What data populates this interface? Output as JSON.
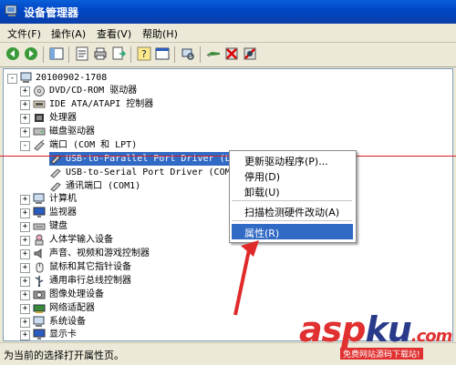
{
  "window": {
    "title": "设备管理器"
  },
  "menu": [
    {
      "label": "文件(F)"
    },
    {
      "label": "操作(A)"
    },
    {
      "label": "查看(V)"
    },
    {
      "label": "帮助(H)"
    }
  ],
  "tree": {
    "root": "20100902-1708",
    "items": [
      {
        "label": "DVD/CD-ROM 驱动器",
        "icon": "cdrom-icon",
        "expander": "+"
      },
      {
        "label": "IDE ATA/ATAPI 控制器",
        "icon": "ide-controller-icon",
        "expander": "+"
      },
      {
        "label": "处理器",
        "icon": "processor-icon",
        "expander": "+"
      },
      {
        "label": "磁盘驱动器",
        "icon": "disk-drive-icon",
        "expander": "+"
      },
      {
        "label": "端口 (COM 和 LPT)",
        "icon": "port-icon",
        "expander": "-"
      },
      {
        "label": "计算机",
        "icon": "computer-icon",
        "expander": "+"
      },
      {
        "label": "监视器",
        "icon": "monitor-icon",
        "expander": "+"
      },
      {
        "label": "键盘",
        "icon": "keyboard-icon",
        "expander": "+"
      },
      {
        "label": "人体学输入设备",
        "icon": "hid-icon",
        "expander": "+"
      },
      {
        "label": "声音、视频和游戏控制器",
        "icon": "sound-icon",
        "expander": "+"
      },
      {
        "label": "鼠标和其它指针设备",
        "icon": "mouse-icon",
        "expander": "+"
      },
      {
        "label": "通用串行总线控制器",
        "icon": "usb-icon",
        "expander": "+"
      },
      {
        "label": "图像处理设备",
        "icon": "imaging-icon",
        "expander": "+"
      },
      {
        "label": "网络适配器",
        "icon": "network-icon",
        "expander": "+"
      },
      {
        "label": "系统设备",
        "icon": "system-icon",
        "expander": "+"
      },
      {
        "label": "显示卡",
        "icon": "display-icon",
        "expander": "+"
      }
    ],
    "ports": [
      {
        "label": "USB-to-Parallel Port Driver (LPT1)",
        "selected": true
      },
      {
        "label": "USB-to-Serial Port Driver (COM4)",
        "selected": false
      },
      {
        "label": "通讯端口 (COM1)",
        "selected": false
      }
    ]
  },
  "context_menu": {
    "items": [
      {
        "label": "更新驱动程序(P)..."
      },
      {
        "label": "停用(D)"
      },
      {
        "label": "卸载(U)"
      },
      {
        "label": "扫描检测硬件改动(A)"
      },
      {
        "label": "属性(R)",
        "highlighted": true
      }
    ]
  },
  "status": {
    "text": "为当前的选择打开属性页。"
  },
  "watermark": {
    "main": "aspku",
    "dotcom": ".com",
    "sub": "免费网站源码下载站!"
  },
  "colors": {
    "selection": "#316ac5",
    "annotation": "#d81e1e",
    "titlebar": "#0a5fd8"
  }
}
